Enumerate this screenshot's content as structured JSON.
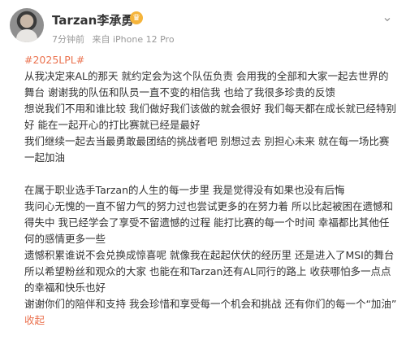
{
  "user": {
    "name": "Tarzan李承勇",
    "time": "7分钟前",
    "source": "来自 iPhone 12 Pro"
  },
  "post": {
    "hashtag": "#2025LPL#",
    "paragraph1": "从我决定来AL的那天 就约定会为这个队伍负责 会用我的全部和大家一起去世界的舞台 谢谢我的队伍和队员一直不变的相信我 也给了我很多珍贵的反馈",
    "paragraph2": "想说我们不用和谁比较 我们做好我们该做的就会很好 我们每天都在成长就已经特别好 能在一起开心的打比赛就已经是最好",
    "paragraph3": "我们继续一起去当最勇敢最团结的挑战者吧 别想过去 别担心未来 就在每一场比赛一起加油",
    "paragraph4": "在属于职业选手Tarzan的人生的每一步里 我是觉得没有如果也没有后悔",
    "paragraph5": "我问心无愧的一直不留力气的努力过也尝试更多的在努力着 所以比起被困在遗憾和得失中 我已经学会了享受不留遗憾的过程 能打比赛的每一个时间 幸福都比其他任何的感情更多一些",
    "paragraph6": "遗憾积累谁说不会兑换成惊喜呢 就像我在起起伏伏的经历里 还是进入了MSI的舞台",
    "paragraph7": "所以希望粉丝和观众的大家 也能在和Tarzan还有AL同行的路上 收获哪怕多一点点的幸福和快乐也好",
    "paragraph8": "谢谢你们的陪伴和支持 我会珍惜和享受每一个机会和挑战 还有你们的每一个“加油”",
    "collapse_label": "收起"
  },
  "colors": {
    "accent": "#eb7350",
    "meta": "#999999",
    "text": "#333333",
    "badge": "#f5b43b"
  },
  "icons": {
    "more": "chevron-down-icon",
    "vip": "vip-badge-icon"
  }
}
